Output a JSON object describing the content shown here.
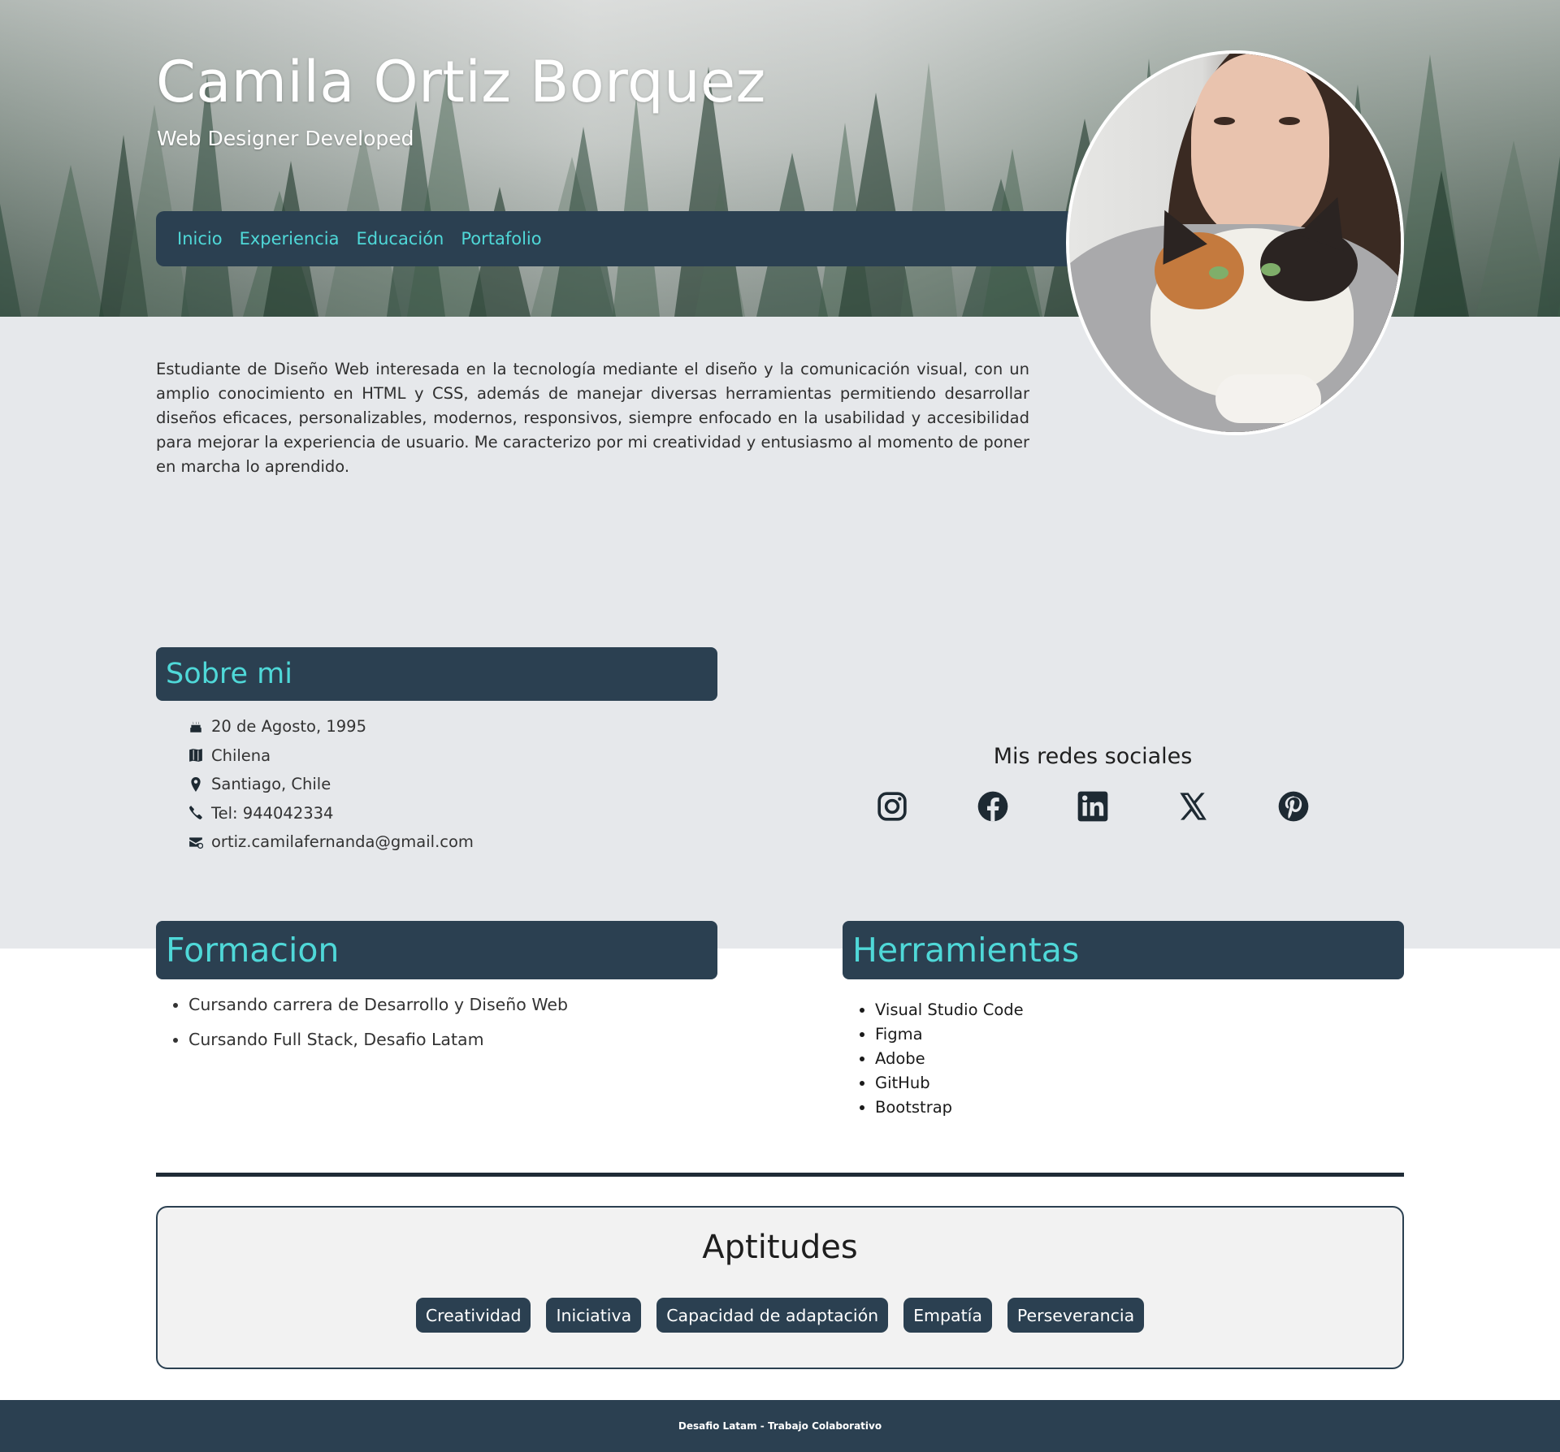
{
  "hero": {
    "name": "Camila Ortiz Borquez",
    "subtitle": "Web Designer Developed"
  },
  "nav": {
    "items": [
      "Inicio",
      "Experiencia",
      "Educación",
      "Portafolio"
    ]
  },
  "intro": {
    "text": "Estudiante de Diseño Web interesada en la tecnología mediante el diseño y la comunicación visual, con un amplio conocimiento en HTML y CSS, además de manejar diversas herramientas permitiendo desarrollar diseños eficaces, personalizables, modernos, responsivos, siempre enfocado en la usabilidad y accesibilidad para mejorar la experiencia de usuario. Me caracterizo por mi creatividad y entusiasmo al momento de poner en marcha lo aprendido."
  },
  "about": {
    "title": "Sobre mi",
    "items": [
      {
        "icon": "cake-icon",
        "text": "20 de Agosto, 1995"
      },
      {
        "icon": "map-icon",
        "text": "Chilena"
      },
      {
        "icon": "location-pin-icon",
        "text": "Santiago, Chile"
      },
      {
        "icon": "phone-icon",
        "text": "Tel: 944042334"
      },
      {
        "icon": "envelope-at-icon",
        "text": "ortiz.camilafernanda@gmail.com"
      }
    ]
  },
  "social": {
    "title": "Mis redes sociales",
    "icons": [
      "instagram-icon",
      "facebook-icon",
      "linkedin-icon",
      "x-twitter-icon",
      "pinterest-icon"
    ]
  },
  "formacion": {
    "title": "Formacion",
    "items": [
      "Cursando carrera de Desarrollo y Diseño Web",
      "Cursando Full Stack, Desafio Latam"
    ]
  },
  "herramientas": {
    "title": "Herramientas",
    "items": [
      "Visual Studio Code",
      "Figma",
      "Adobe",
      "GitHub",
      "Bootstrap"
    ]
  },
  "aptitudes": {
    "title": "Aptitudes",
    "items": [
      "Creatividad",
      "Iniciativa",
      "Capacidad de adaptación",
      "Empatía",
      "Perseverancia"
    ]
  },
  "footer": {
    "text": "Desafio Latam - Trabajo Colaborativo"
  },
  "colors": {
    "navy": "#2b4051",
    "accent": "#4fd8d8",
    "band": "#e6e8eb"
  }
}
